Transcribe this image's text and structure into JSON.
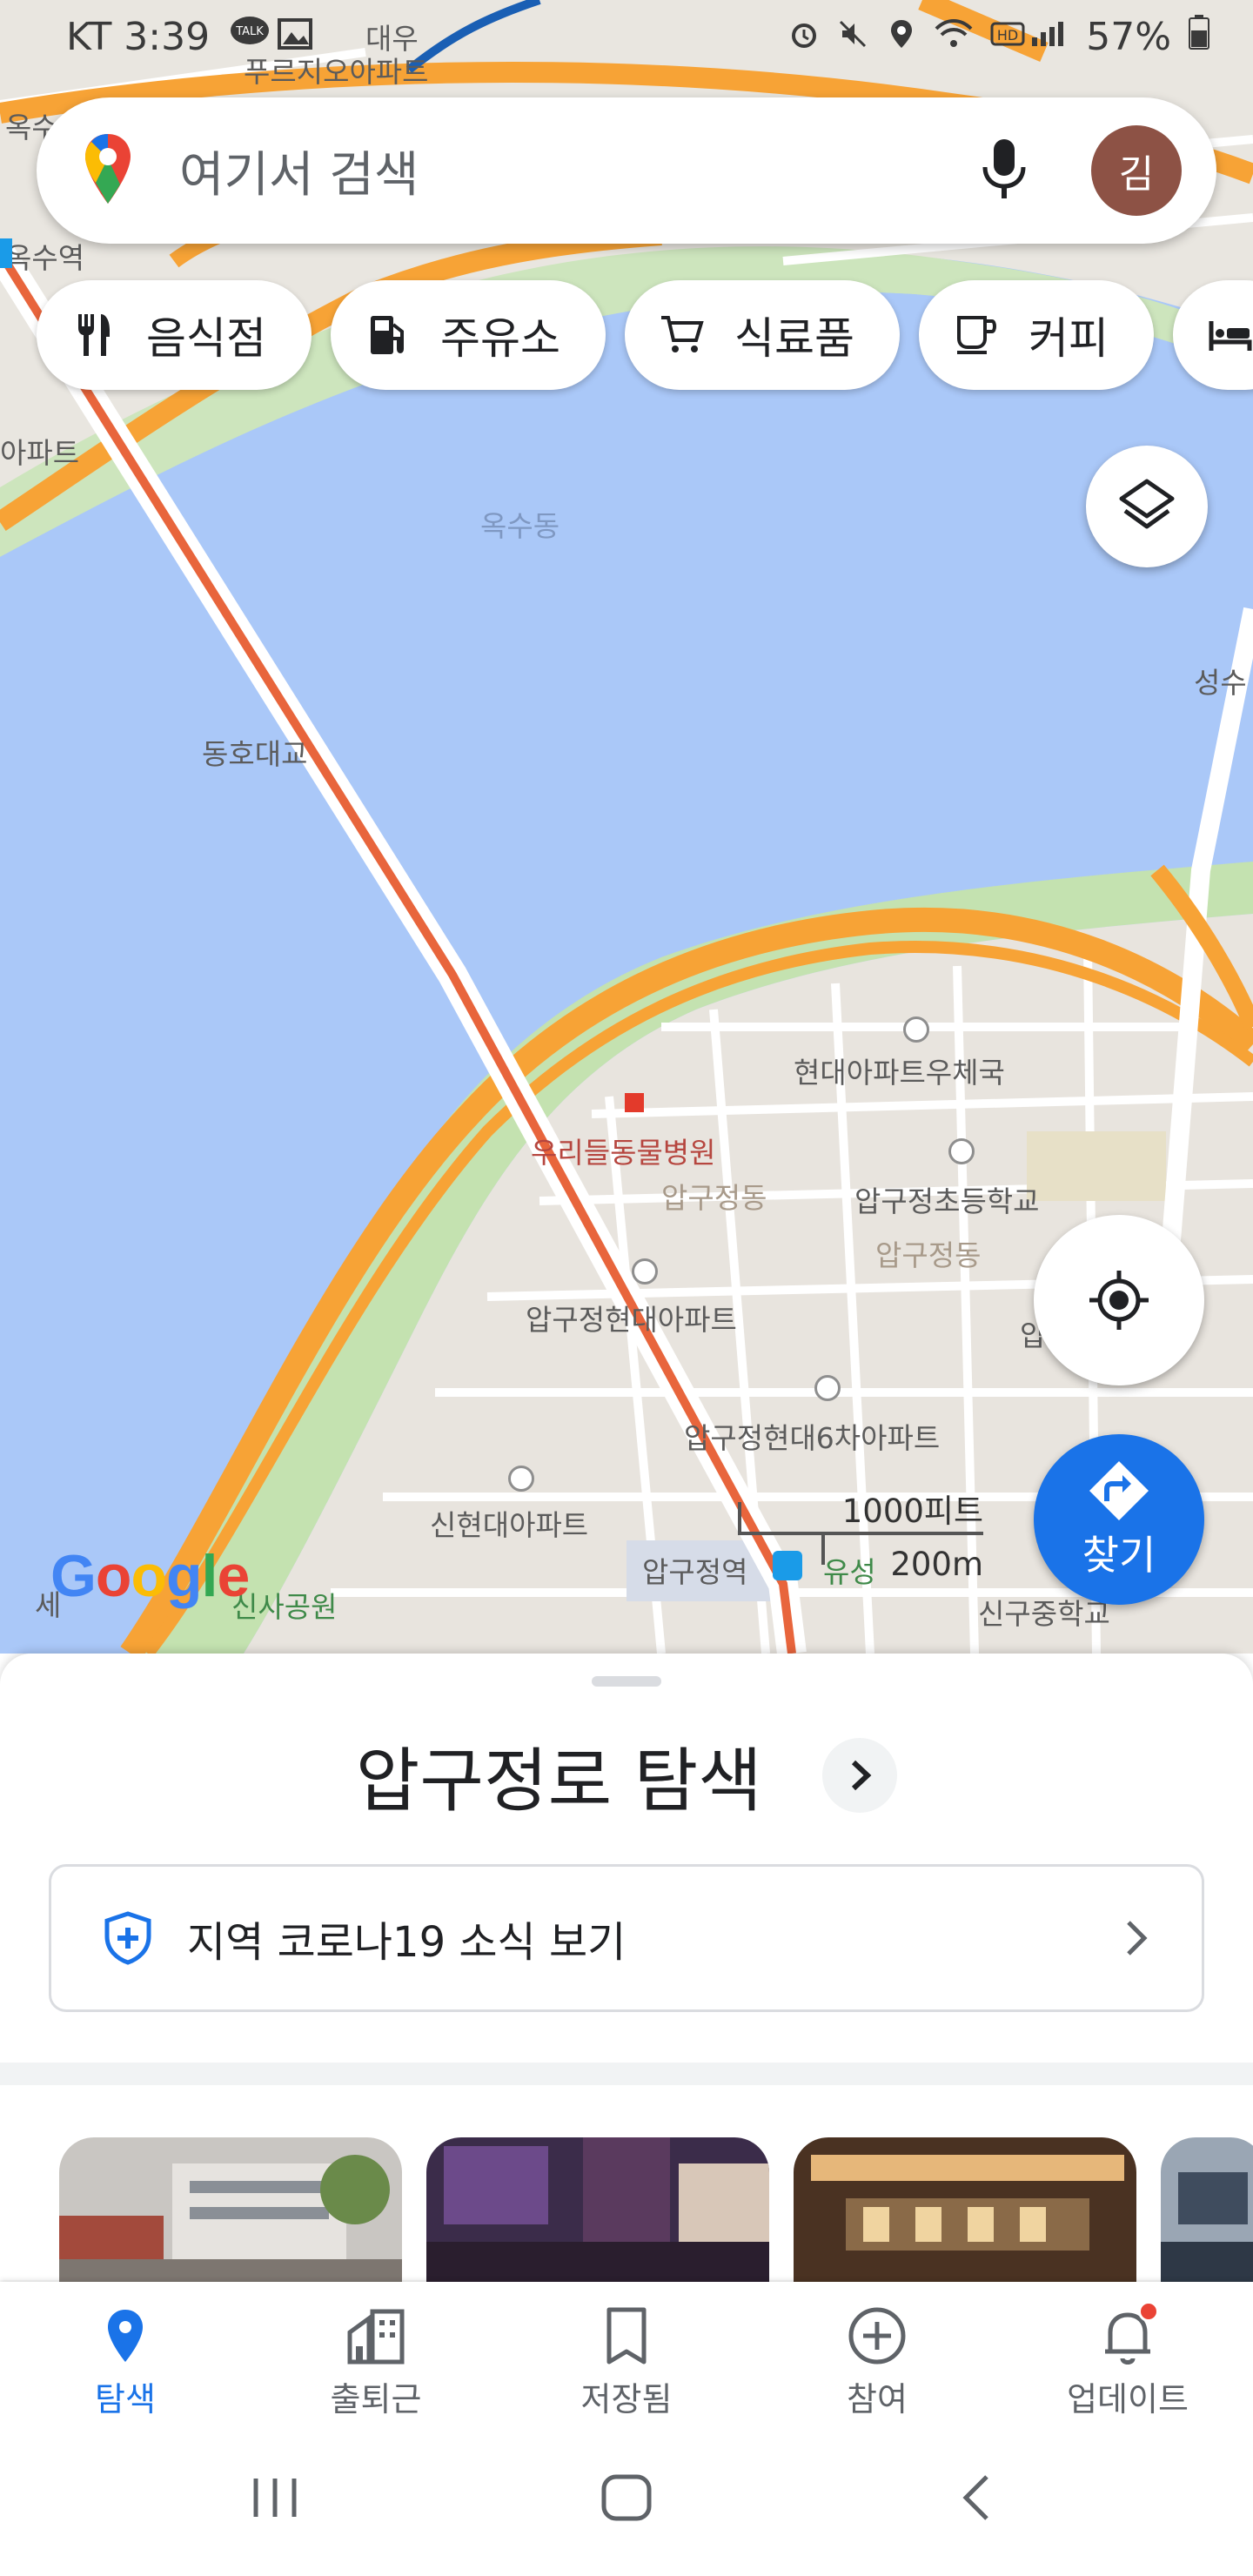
{
  "status_bar": {
    "carrier_time": "KT 3:39",
    "battery": "57%"
  },
  "search": {
    "placeholder": "여기서 검색",
    "avatar_initial": "김"
  },
  "chips": [
    {
      "label": "음식점",
      "icon": "restaurant-icon"
    },
    {
      "label": "주유소",
      "icon": "gas-station-icon"
    },
    {
      "label": "식료품",
      "icon": "shopping-cart-icon"
    },
    {
      "label": "커피",
      "icon": "coffee-icon"
    },
    {
      "label": "",
      "icon": "hotel-icon"
    }
  ],
  "map": {
    "labels": {
      "daewoo": "대우",
      "prugio": "푸르지오아파트",
      "oksu_station": "옥수역",
      "oksu_left": "옥수",
      "apt_left": "아파트",
      "oksu_dong": "옥수동",
      "seongsu": "성수",
      "dongho_bridge": "동호대교",
      "hyundai_post": "현대아파트우체국",
      "animal_hospital": "우리들동물병원",
      "apgujeong_dong_1": "압구정동",
      "apgujeong_school": "압구정초등학교",
      "apgujeong_dong_2": "압구정동",
      "apgujeong_hyundai": "압구정현대아파트",
      "hyundai6": "압구정현대6차아파트",
      "sinhyundai": "신현대아파트",
      "apgujeong_station": "압구정역",
      "yuseong": "유성",
      "sinsa_park": "신사공원",
      "sinsa_left": "세 ",
      "singu_school": "신구중학교",
      "ap_right": "압"
    },
    "scale_feet": "1000피트",
    "scale_meters": "200m",
    "google_logo": "Google"
  },
  "directions_label": "찾기",
  "sheet": {
    "title": "압구정로 탐색",
    "covid_label": "지역 코로나19 소식 보기"
  },
  "bottom_nav": [
    {
      "label": "탐색",
      "icon": "explore-pin-icon",
      "active": true
    },
    {
      "label": "출퇴근",
      "icon": "commute-icon",
      "active": false
    },
    {
      "label": "저장됨",
      "icon": "bookmark-icon",
      "active": false
    },
    {
      "label": "참여",
      "icon": "add-circle-icon",
      "active": false
    },
    {
      "label": "업데이트",
      "icon": "bell-icon",
      "active": false
    }
  ],
  "colors": {
    "accent": "#1a73e8",
    "water": "#aac8f8",
    "road_major": "#f7a336",
    "road_red": "#e8653c",
    "avatar_bg": "#8d5245"
  }
}
